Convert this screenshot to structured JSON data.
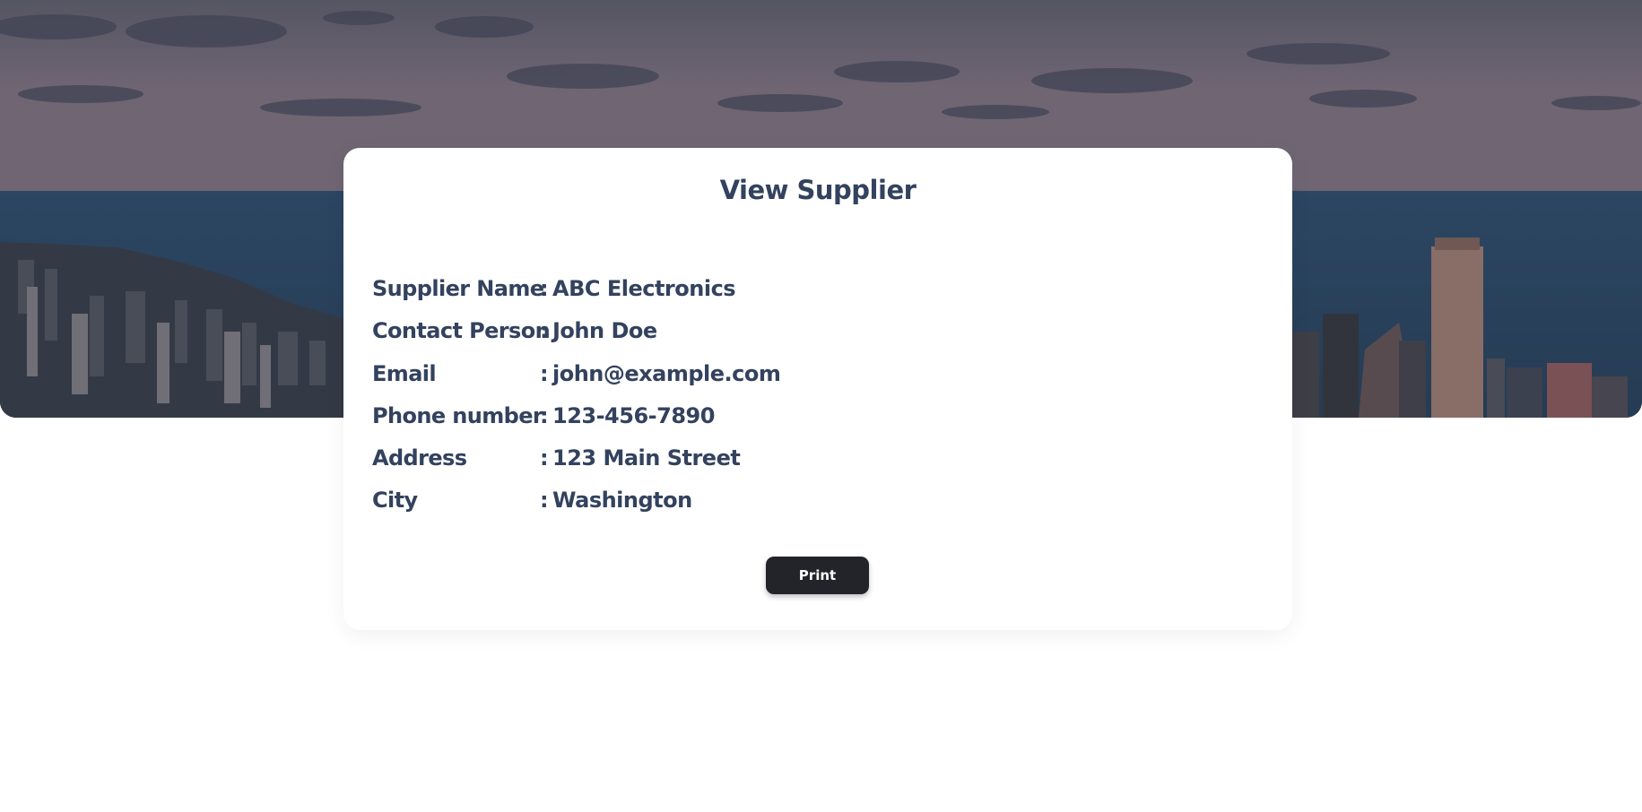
{
  "page": {
    "title": "View Supplier",
    "print_label": "Print"
  },
  "supplier": {
    "rows": [
      {
        "label": "Supplier Name",
        "sep": ":",
        "value": "ABC Electronics"
      },
      {
        "label": "Contact Person",
        "sep": ":",
        "value": "John Doe"
      },
      {
        "label": "Email",
        "sep": ":",
        "value": "john@example.com"
      },
      {
        "label": "Phone number",
        "sep": ":",
        "value": "123-456-7890"
      },
      {
        "label": "Address",
        "sep": ":",
        "value": "123 Main Street"
      },
      {
        "label": "City",
        "sep": ":",
        "value": "Washington"
      }
    ]
  },
  "colors": {
    "text": "#33425e",
    "button_bg": "#22242a",
    "card_bg": "#ffffff"
  },
  "hero": {
    "image": "city-skyline-background"
  }
}
